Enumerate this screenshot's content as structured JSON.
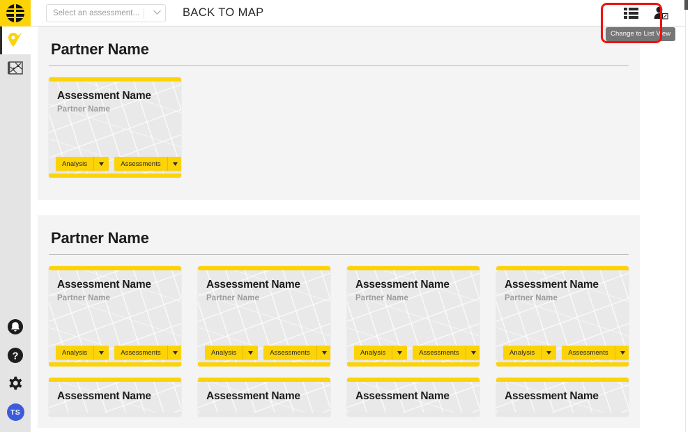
{
  "topbar": {
    "logo_name": "app-logo",
    "select_placeholder": "Select an assessment...",
    "back_to_map": "BACK TO MAP",
    "list_view_tooltip": "Change to List View",
    "highlight_color": "#ee1111",
    "accent_color": "#FCD307"
  },
  "sidebar": {
    "items": [
      {
        "name": "map-pin-icon",
        "label": "Map Pin",
        "active": true
      },
      {
        "name": "map-sheet-icon",
        "label": "Map",
        "active": false
      }
    ],
    "bottom_items": [
      {
        "name": "bell-icon",
        "label": "Notifications"
      },
      {
        "name": "help-icon",
        "label": "Help"
      },
      {
        "name": "gear-icon",
        "label": "Settings"
      }
    ],
    "avatar_initials": "TS",
    "avatar_color": "#3b5bdb"
  },
  "sections": [
    {
      "title": "Partner Name",
      "cards": [
        {
          "title": "Assessment Name",
          "subtitle": "Partner Name",
          "analysis_label": "Analysis",
          "assessments_label": "Assessments"
        }
      ]
    },
    {
      "title": "Partner Name",
      "cards": [
        {
          "title": "Assessment Name",
          "subtitle": "Partner Name",
          "analysis_label": "Analysis",
          "assessments_label": "Assessments"
        },
        {
          "title": "Assessment Name",
          "subtitle": "Partner Name",
          "analysis_label": "Analysis",
          "assessments_label": "Assessments"
        },
        {
          "title": "Assessment Name",
          "subtitle": "Partner Name",
          "analysis_label": "Analysis",
          "assessments_label": "Assessments"
        },
        {
          "title": "Assessment Name",
          "subtitle": "Partner Name",
          "analysis_label": "Analysis",
          "assessments_label": "Assessments"
        }
      ],
      "clipped_cards": [
        {
          "title": "Assessment Name"
        },
        {
          "title": "Assessment Name"
        },
        {
          "title": "Assessment Name"
        },
        {
          "title": "Assessment Name"
        }
      ]
    }
  ]
}
